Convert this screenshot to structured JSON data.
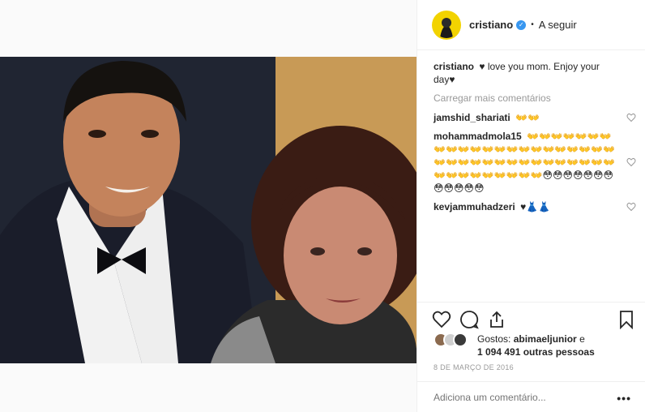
{
  "post": {
    "username": "cristiano",
    "follow_label": "A seguir",
    "dot": "•",
    "verified_mark": "✓"
  },
  "comments": [
    {
      "user": "cristiano",
      "text": "♥ love you mom. Enjoy your day♥"
    },
    {
      "user": "jamshid_shariati",
      "text": "👐👐"
    },
    {
      "user": "mohammadmola15",
      "text": "👐👐👐👐👐👐👐👐👐👐👐👐👐👐👐👐👐👐👐👐👐👐👐👐👐👐👐👐👐👐👐👐👐👐👐👐👐👐👐👐👐👐👐👐👐👐😳😳😳😳😳😳😳😳😳😳😳😳"
    },
    {
      "user": "kevjammuhadzeri",
      "text": "♥👗👗"
    }
  ],
  "load_more_label": "Carregar mais comentários",
  "likes": {
    "prefix": "Gostos:",
    "first_user": "abimaeljunior",
    "connector": "e",
    "others": "1 094 491 outras pessoas"
  },
  "date": "8 DE MARÇO DE 2016",
  "add_comment_placeholder": "Adiciona um comentário...",
  "more_label": "•••",
  "colors": {
    "verified": "#3897f0",
    "avatar_bg": "#f2d300",
    "muted": "#999999"
  },
  "icons": [
    "heart-icon",
    "comment-icon",
    "share-icon",
    "bookmark-icon",
    "verified-icon"
  ]
}
